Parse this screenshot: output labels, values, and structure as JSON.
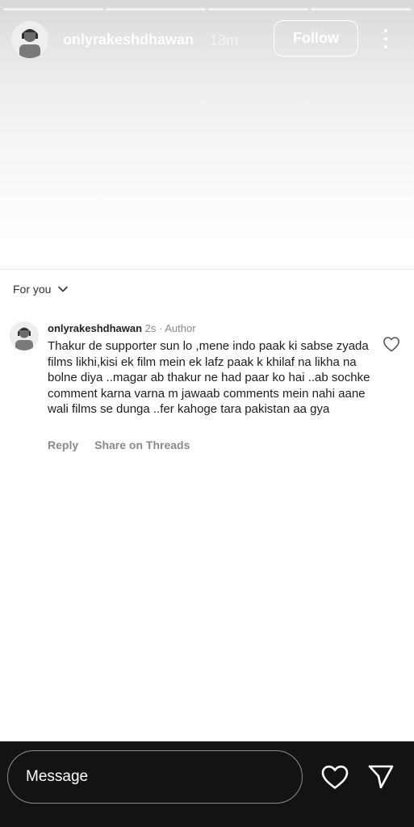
{
  "story": {
    "username": "onlyrakeshdhawan",
    "time": "18m",
    "follow_label": "Follow",
    "progress_segments": 4
  },
  "feed": {
    "filter_label": "For you"
  },
  "comment": {
    "username": "onlyrakeshdhawan",
    "meta": " 2s · Author",
    "text": "Thakur de supporter sun lo ,mene indo paak ki sabse zyada films likhi,kisi ek film mein ek lafz paak k khilaf na likha na bolne diya ..magar ab thakur ne had paar ko hai ..ab sochke comment karna varna m jawaab comments mein nahi aane wali films se dunga ..fer kahoge tara pakistan aa gya",
    "reply_label": "Reply",
    "share_label": "Share on Threads"
  },
  "bottom_bar": {
    "message_placeholder": "Message"
  },
  "icons": {
    "more": "more-vertical-icon",
    "chevron": "chevron-down-icon",
    "like": "heart-icon",
    "send": "send-icon"
  },
  "colors": {
    "bottom_bar": "#131313",
    "meta_text": "#8a8a8a"
  }
}
